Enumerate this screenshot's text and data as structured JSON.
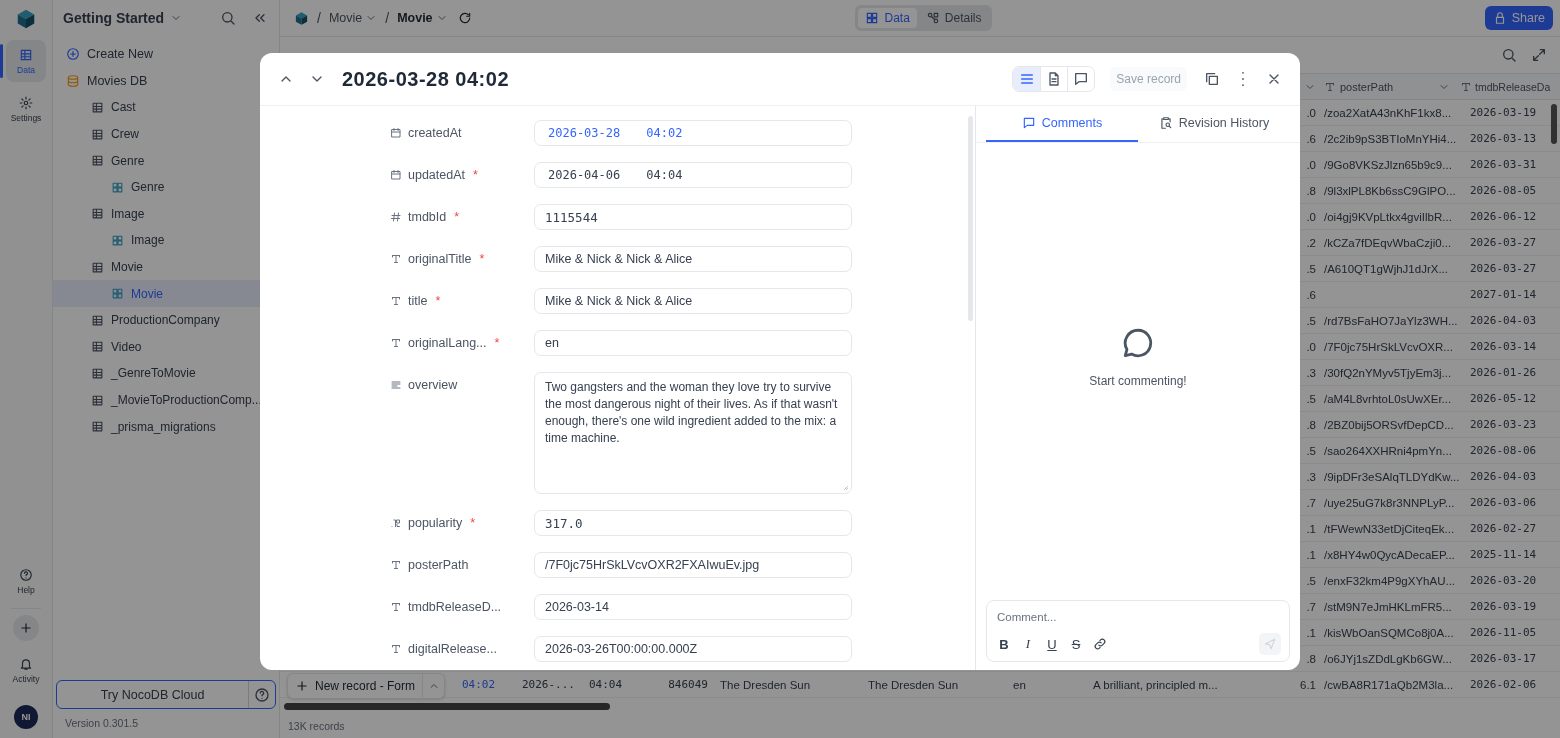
{
  "rail": {
    "items": [
      {
        "label": "Data",
        "kind": "data",
        "selected": true
      },
      {
        "label": "Settings",
        "kind": "settings",
        "selected": false
      }
    ],
    "bottom_items": [
      {
        "label": "Help",
        "kind": "help"
      },
      {
        "label": "Activity",
        "kind": "activity"
      }
    ],
    "avatar": "NI"
  },
  "sidebar": {
    "workspace": "Getting Started",
    "create_new": "Create New",
    "base": "Movies DB",
    "tree": [
      {
        "label": "Cast",
        "kind": "table",
        "selected": false
      },
      {
        "label": "Crew",
        "kind": "table",
        "selected": false
      },
      {
        "label": "Genre",
        "kind": "table",
        "selected": false,
        "children": [
          {
            "label": "Genre",
            "kind": "view",
            "selected": false
          }
        ]
      },
      {
        "label": "Image",
        "kind": "table",
        "selected": false,
        "children": [
          {
            "label": "Image",
            "kind": "view",
            "selected": false
          }
        ]
      },
      {
        "label": "Movie",
        "kind": "table",
        "selected": false,
        "children": [
          {
            "label": "Movie",
            "kind": "view",
            "selected": true
          }
        ]
      },
      {
        "label": "ProductionCompany",
        "kind": "table",
        "selected": false
      },
      {
        "label": "Video",
        "kind": "table",
        "selected": false
      },
      {
        "label": "_GenreToMovie",
        "kind": "table",
        "selected": false
      },
      {
        "label": "_MovieToProductionComp...",
        "kind": "table",
        "selected": false
      },
      {
        "label": "_prisma_migrations",
        "kind": "table",
        "selected": false
      }
    ],
    "try_cloud": "Try NocoDB Cloud",
    "version": "Version 0.301.5"
  },
  "topbar": {
    "separator": "/",
    "breadcrumb": [
      "Movie",
      "Movie"
    ],
    "tabs": [
      {
        "label": "Data",
        "kind": "data",
        "selected": true
      },
      {
        "label": "Details",
        "kind": "details",
        "selected": false
      }
    ],
    "share": "Share"
  },
  "grid": {
    "header": [
      "posterPath",
      "tmdbReleaseDa"
    ],
    "rows": [
      {
        "popularity": ".0",
        "posterPath": "/zoa2XatA43nKhF1kx8...",
        "tmdbReleaseDate": "2026-03-19"
      },
      {
        "popularity": ".6",
        "posterPath": "/2c2ib9pS3BTIoMnYHi4...",
        "tmdbReleaseDate": "2026-03-13"
      },
      {
        "popularity": ".0",
        "posterPath": "/9Go8VKSzJlzn65b9c9...",
        "tmdbReleaseDate": "2026-03-31"
      },
      {
        "popularity": ".8",
        "posterPath": "/9l3xlPL8Kb6ssC9GlPO...",
        "tmdbReleaseDate": "2026-08-05"
      },
      {
        "popularity": ".0",
        "posterPath": "/oi4gj9KVpLtkx4gviIlbR...",
        "tmdbReleaseDate": "2026-06-12"
      },
      {
        "popularity": ".2",
        "posterPath": "/kCZa7fDEqvWbaCzji0...",
        "tmdbReleaseDate": "2026-03-27"
      },
      {
        "popularity": ".5",
        "posterPath": "/A610QT1gWjhJ1dJrX...",
        "tmdbReleaseDate": "2026-03-27"
      },
      {
        "popularity": ".6",
        "tmdbReleaseDate": "2027-01-14"
      },
      {
        "popularity": ".5",
        "posterPath": "/rd7BsFaHO7JaYlz3WH...",
        "tmdbReleaseDate": "2026-04-03"
      },
      {
        "popularity": ".0",
        "posterPath": "/7F0jc75HrSkLVcvOXR...",
        "tmdbReleaseDate": "2026-03-14"
      },
      {
        "popularity": ".3",
        "posterPath": "/30fQ2nYMyv5TjyEm3j...",
        "tmdbReleaseDate": "2026-01-26"
      },
      {
        "popularity": ".5",
        "posterPath": "/aM4L8vrhtoL0sUwXEr...",
        "tmdbReleaseDate": "2026-05-12"
      },
      {
        "popularity": ".8",
        "posterPath": "/2BZ0bij5ORSvfDepCD...",
        "tmdbReleaseDate": "2026-03-23"
      },
      {
        "popularity": ".5",
        "posterPath": "/sao264XXHRni4pmYn...",
        "tmdbReleaseDate": "2026-08-06"
      },
      {
        "popularity": ".3",
        "posterPath": "/9ipDFr3eSAlqTLDYdKw...",
        "tmdbReleaseDate": "2026-04-03"
      },
      {
        "popularity": ".7",
        "posterPath": "/uye25uG7k8r3NNPLyP...",
        "tmdbReleaseDate": "2026-03-06"
      },
      {
        "popularity": ".1",
        "posterPath": "/tFWewN33etDjCiteqEk...",
        "tmdbReleaseDate": "2026-02-27"
      },
      {
        "popularity": ".1",
        "posterPath": "/x8HY4w0QycADecaEP...",
        "tmdbReleaseDate": "2025-11-14"
      },
      {
        "popularity": ".5",
        "posterPath": "/enxF32km4P9gXYhAU...",
        "tmdbReleaseDate": "2026-03-20"
      },
      {
        "popularity": ".7",
        "posterPath": "/stM9N7eJmHKLmFR5...",
        "tmdbReleaseDate": "2026-03-19"
      },
      {
        "popularity": ".1",
        "posterPath": "/kisWbOanSQMCo8j0A...",
        "tmdbReleaseDate": "2026-11-05"
      },
      {
        "popularity": ".8",
        "posterPath": "/o6JYj1sZDdLgKb6GW...",
        "tmdbReleaseDate": "2026-03-17"
      }
    ],
    "last_row": {
      "createdAt": "04:02",
      "updatedAt_date": "2026-...",
      "updatedAt_time": "04:04",
      "tmdbId": "846049",
      "originalTitle": "The Dresden Sun",
      "title": "The Dresden Sun",
      "originalLanguage": "en",
      "overview": "A brilliant, principled m...",
      "popularity": "6.1",
      "posterPath": "/cwBA8R171aQb2M3la...",
      "tmdbReleaseDate": "2026-02-06"
    },
    "new_record": "New record - Form",
    "record_count": "13K records"
  },
  "record": {
    "title": "2026-03-28 04:02",
    "required_mark": "*",
    "view_modes": [
      {
        "kind": "fields",
        "selected": true
      },
      {
        "kind": "files",
        "selected": false
      },
      {
        "kind": "comments",
        "selected": false
      }
    ],
    "save": {
      "label": "Save record",
      "disabled": true
    },
    "fields": [
      {
        "label": "createdAt",
        "kind": "datetime",
        "required": false,
        "highlighted": true,
        "date": "2026-03-28",
        "time": "04:02"
      },
      {
        "label": "updatedAt",
        "kind": "datetime",
        "required": true,
        "highlighted": false,
        "date": "2026-04-06",
        "time": "04:04"
      },
      {
        "label": "tmdbId",
        "kind": "number",
        "required": true,
        "highlighted": false,
        "value": "1115544"
      },
      {
        "label": "originalTitle",
        "kind": "text",
        "required": true,
        "highlighted": false,
        "value": "Mike & Nick & Nick & Alice"
      },
      {
        "label": "title",
        "kind": "text",
        "required": true,
        "highlighted": false,
        "value": "Mike & Nick & Nick & Alice"
      },
      {
        "label": "originalLang...",
        "kind": "text",
        "required": true,
        "highlighted": false,
        "value": "en"
      },
      {
        "label": "overview",
        "kind": "longtext",
        "required": false,
        "highlighted": false,
        "value": "Two gangsters and the woman they love try to survive the most dangerous night of their lives. As if that wasn't enough, there's one wild ingredient added to the mix: a time machine."
      },
      {
        "label": "popularity",
        "kind": "decimal",
        "required": true,
        "highlighted": false,
        "value": "317.0"
      },
      {
        "label": "posterPath",
        "kind": "text",
        "required": false,
        "highlighted": false,
        "value": "/7F0jc75HrSkLVcvOXR2FXAIwuEv.jpg"
      },
      {
        "label": "tmdbReleaseD...",
        "kind": "text",
        "required": false,
        "highlighted": false,
        "value": "2026-03-14"
      },
      {
        "label": "digitalRelease...",
        "kind": "text",
        "required": false,
        "highlighted": false,
        "value": "2026-03-26T00:00:00.000Z"
      }
    ],
    "panel_tabs": [
      {
        "label": "Comments",
        "kind": "comments",
        "selected": true
      },
      {
        "label": "Revision History",
        "kind": "history",
        "selected": false
      }
    ],
    "empty_text": "Start commenting!",
    "comment_placeholder": "Comment...",
    "format_buttons": [
      {
        "label": "B",
        "kind": "bold"
      },
      {
        "label": "I",
        "kind": "italic"
      },
      {
        "label": "U",
        "kind": "underline"
      },
      {
        "label": "S",
        "kind": "strike"
      },
      {
        "kind": "link"
      }
    ],
    "send_disabled": true
  }
}
